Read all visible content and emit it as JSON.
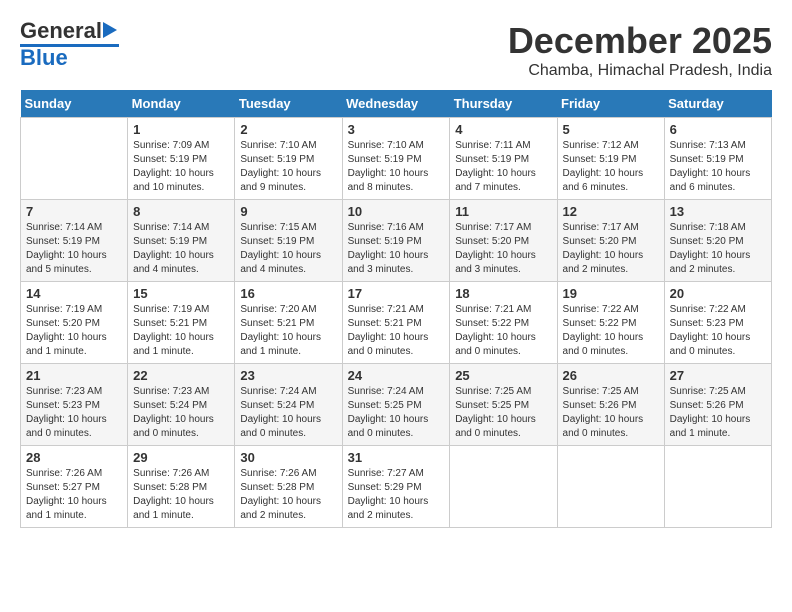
{
  "logo": {
    "line1": "General",
    "line2": "Blue"
  },
  "title": "December 2025",
  "subtitle": "Chamba, Himachal Pradesh, India",
  "days_header": [
    "Sunday",
    "Monday",
    "Tuesday",
    "Wednesday",
    "Thursday",
    "Friday",
    "Saturday"
  ],
  "weeks": [
    [
      {
        "num": "",
        "info": ""
      },
      {
        "num": "1",
        "info": "Sunrise: 7:09 AM\nSunset: 5:19 PM\nDaylight: 10 hours\nand 10 minutes."
      },
      {
        "num": "2",
        "info": "Sunrise: 7:10 AM\nSunset: 5:19 PM\nDaylight: 10 hours\nand 9 minutes."
      },
      {
        "num": "3",
        "info": "Sunrise: 7:10 AM\nSunset: 5:19 PM\nDaylight: 10 hours\nand 8 minutes."
      },
      {
        "num": "4",
        "info": "Sunrise: 7:11 AM\nSunset: 5:19 PM\nDaylight: 10 hours\nand 7 minutes."
      },
      {
        "num": "5",
        "info": "Sunrise: 7:12 AM\nSunset: 5:19 PM\nDaylight: 10 hours\nand 6 minutes."
      },
      {
        "num": "6",
        "info": "Sunrise: 7:13 AM\nSunset: 5:19 PM\nDaylight: 10 hours\nand 6 minutes."
      }
    ],
    [
      {
        "num": "7",
        "info": "Sunrise: 7:14 AM\nSunset: 5:19 PM\nDaylight: 10 hours\nand 5 minutes."
      },
      {
        "num": "8",
        "info": "Sunrise: 7:14 AM\nSunset: 5:19 PM\nDaylight: 10 hours\nand 4 minutes."
      },
      {
        "num": "9",
        "info": "Sunrise: 7:15 AM\nSunset: 5:19 PM\nDaylight: 10 hours\nand 4 minutes."
      },
      {
        "num": "10",
        "info": "Sunrise: 7:16 AM\nSunset: 5:19 PM\nDaylight: 10 hours\nand 3 minutes."
      },
      {
        "num": "11",
        "info": "Sunrise: 7:17 AM\nSunset: 5:20 PM\nDaylight: 10 hours\nand 3 minutes."
      },
      {
        "num": "12",
        "info": "Sunrise: 7:17 AM\nSunset: 5:20 PM\nDaylight: 10 hours\nand 2 minutes."
      },
      {
        "num": "13",
        "info": "Sunrise: 7:18 AM\nSunset: 5:20 PM\nDaylight: 10 hours\nand 2 minutes."
      }
    ],
    [
      {
        "num": "14",
        "info": "Sunrise: 7:19 AM\nSunset: 5:20 PM\nDaylight: 10 hours\nand 1 minute."
      },
      {
        "num": "15",
        "info": "Sunrise: 7:19 AM\nSunset: 5:21 PM\nDaylight: 10 hours\nand 1 minute."
      },
      {
        "num": "16",
        "info": "Sunrise: 7:20 AM\nSunset: 5:21 PM\nDaylight: 10 hours\nand 1 minute."
      },
      {
        "num": "17",
        "info": "Sunrise: 7:21 AM\nSunset: 5:21 PM\nDaylight: 10 hours\nand 0 minutes."
      },
      {
        "num": "18",
        "info": "Sunrise: 7:21 AM\nSunset: 5:22 PM\nDaylight: 10 hours\nand 0 minutes."
      },
      {
        "num": "19",
        "info": "Sunrise: 7:22 AM\nSunset: 5:22 PM\nDaylight: 10 hours\nand 0 minutes."
      },
      {
        "num": "20",
        "info": "Sunrise: 7:22 AM\nSunset: 5:23 PM\nDaylight: 10 hours\nand 0 minutes."
      }
    ],
    [
      {
        "num": "21",
        "info": "Sunrise: 7:23 AM\nSunset: 5:23 PM\nDaylight: 10 hours\nand 0 minutes."
      },
      {
        "num": "22",
        "info": "Sunrise: 7:23 AM\nSunset: 5:24 PM\nDaylight: 10 hours\nand 0 minutes."
      },
      {
        "num": "23",
        "info": "Sunrise: 7:24 AM\nSunset: 5:24 PM\nDaylight: 10 hours\nand 0 minutes."
      },
      {
        "num": "24",
        "info": "Sunrise: 7:24 AM\nSunset: 5:25 PM\nDaylight: 10 hours\nand 0 minutes."
      },
      {
        "num": "25",
        "info": "Sunrise: 7:25 AM\nSunset: 5:25 PM\nDaylight: 10 hours\nand 0 minutes."
      },
      {
        "num": "26",
        "info": "Sunrise: 7:25 AM\nSunset: 5:26 PM\nDaylight: 10 hours\nand 0 minutes."
      },
      {
        "num": "27",
        "info": "Sunrise: 7:25 AM\nSunset: 5:26 PM\nDaylight: 10 hours\nand 1 minute."
      }
    ],
    [
      {
        "num": "28",
        "info": "Sunrise: 7:26 AM\nSunset: 5:27 PM\nDaylight: 10 hours\nand 1 minute."
      },
      {
        "num": "29",
        "info": "Sunrise: 7:26 AM\nSunset: 5:28 PM\nDaylight: 10 hours\nand 1 minute."
      },
      {
        "num": "30",
        "info": "Sunrise: 7:26 AM\nSunset: 5:28 PM\nDaylight: 10 hours\nand 2 minutes."
      },
      {
        "num": "31",
        "info": "Sunrise: 7:27 AM\nSunset: 5:29 PM\nDaylight: 10 hours\nand 2 minutes."
      },
      {
        "num": "",
        "info": ""
      },
      {
        "num": "",
        "info": ""
      },
      {
        "num": "",
        "info": ""
      }
    ]
  ]
}
